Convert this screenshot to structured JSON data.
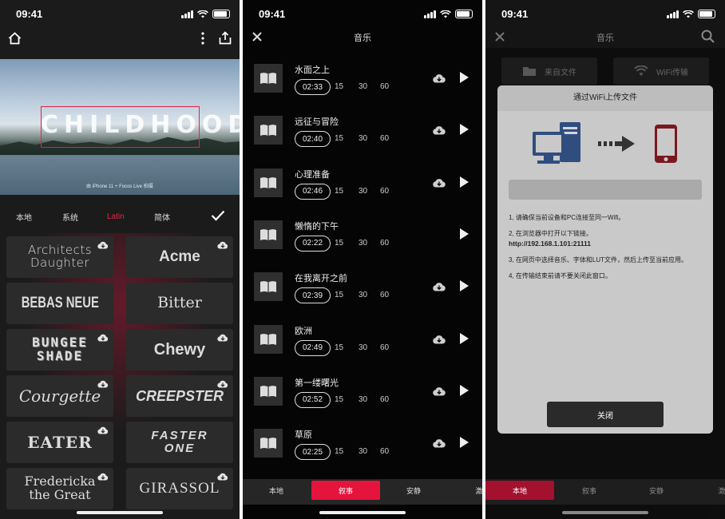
{
  "status_time": "09:41",
  "panel1": {
    "photo_title": "CHILDHOOD",
    "photo_credit": "由 iPhone 11 + Focos Live 拍摄",
    "tabs": [
      "本地",
      "系统",
      "Latin",
      "简体"
    ],
    "active_tab": "Latin",
    "fonts": [
      {
        "label": "Architects Daughter",
        "style": "script"
      },
      {
        "label": "Acme",
        "style": "bold"
      },
      {
        "label": "BEBAS NEUE",
        "style": "condensed"
      },
      {
        "label": "Bitter",
        "style": "serif"
      },
      {
        "label": "BUNGEE SHADE",
        "style": "shade"
      },
      {
        "label": "Chewy",
        "style": "chewy"
      },
      {
        "label": "Courgette",
        "style": "italic"
      },
      {
        "label": "CREEPSTER",
        "style": "creep"
      },
      {
        "label": "EATER",
        "style": "eater"
      },
      {
        "label": "FASTER ONE",
        "style": "faster"
      },
      {
        "label": "Fredericka the Great",
        "style": "fredericka"
      },
      {
        "label": "GIRASSOL",
        "style": "girassol"
      }
    ]
  },
  "panel2": {
    "title": "音乐",
    "duration_options": [
      "15",
      "30",
      "60"
    ],
    "tracks": [
      {
        "name": "水面之上",
        "duration": "02:33",
        "downloadable": true
      },
      {
        "name": "远征与冒险",
        "duration": "02:40",
        "downloadable": true
      },
      {
        "name": "心理准备",
        "duration": "02:46",
        "downloadable": true
      },
      {
        "name": "懒惰的下午",
        "duration": "02:22",
        "downloadable": false
      },
      {
        "name": "在我离开之前",
        "duration": "02:39",
        "downloadable": true
      },
      {
        "name": "欧洲",
        "duration": "02:49",
        "downloadable": true
      },
      {
        "name": "第一缕曙光",
        "duration": "02:52",
        "downloadable": true
      },
      {
        "name": "草原",
        "duration": "02:25",
        "downloadable": true
      }
    ],
    "bottom_tabs": [
      "本地",
      "叙事",
      "安静",
      "激"
    ],
    "active_bottom_tab": "叙事"
  },
  "panel3": {
    "title": "音乐",
    "source_buttons": [
      "来自文件",
      "WiFi传输"
    ],
    "dialog": {
      "title": "通过WiFi上传文件",
      "step1": "1, 请确保当前设备和PC连接至同一Wifi。",
      "step2": "2, 在浏览器中打开以下链接。",
      "url": "http://192.168.1.101:21111",
      "step3": "3, 在网页中选择音乐、字体和LUT文件，然后上传至当前应用。",
      "step4": "4, 在传输结束前请不要关闭此窗口。",
      "close": "关闭"
    },
    "bottom_tabs": [
      "本地",
      "叙事",
      "安静",
      "激"
    ],
    "active_bottom_tab": "本地"
  },
  "colors": {
    "accent": "#e5143d",
    "pc_blue": "#2f4e7e",
    "phone_red": "#7a1820"
  }
}
